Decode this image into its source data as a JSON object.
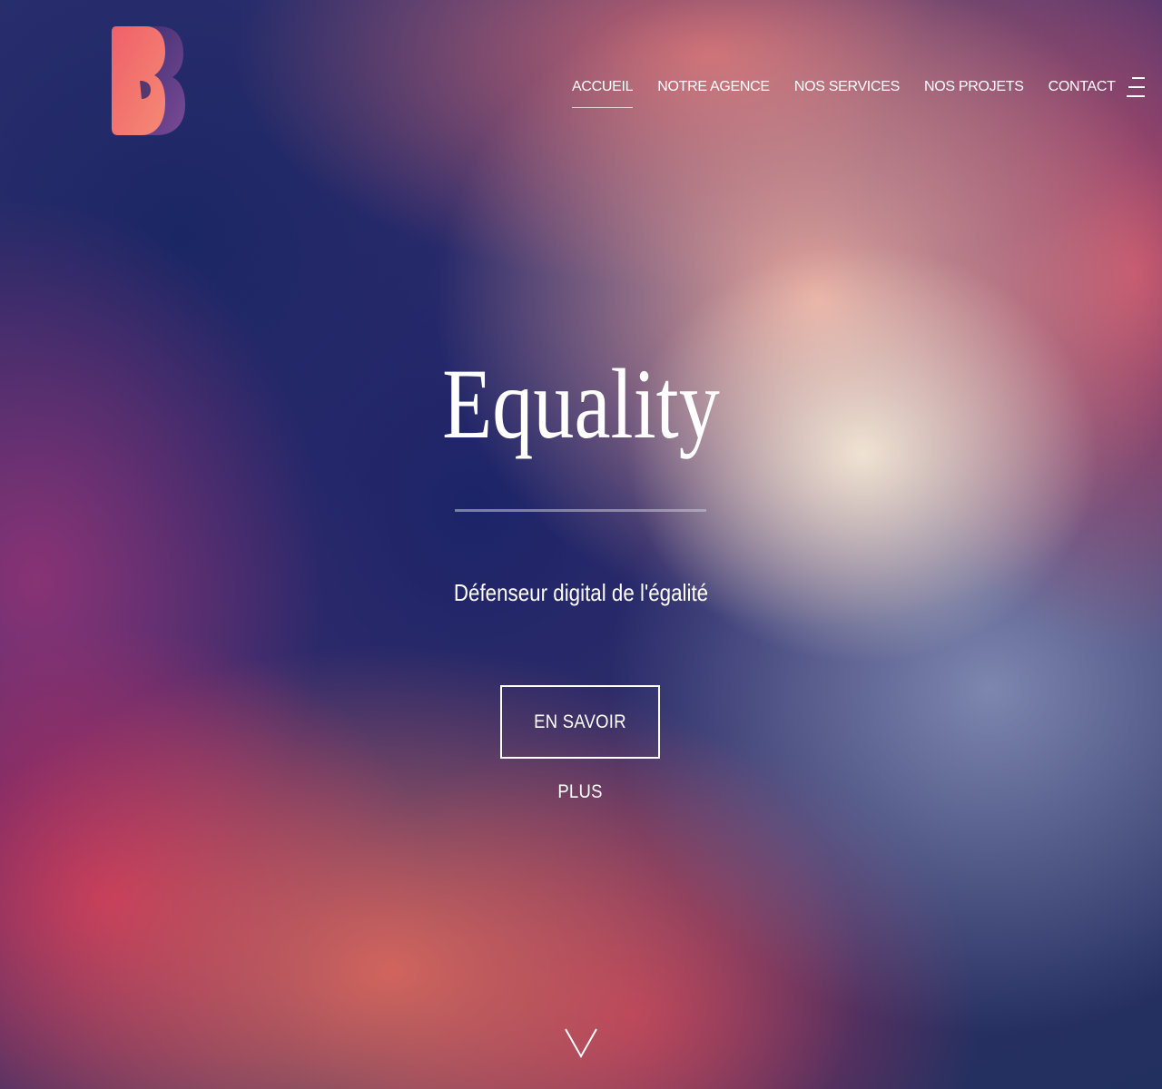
{
  "nav": {
    "items": [
      {
        "label": "ACCUEIL",
        "active": true
      },
      {
        "label": "NOTRE AGENCE",
        "active": false
      },
      {
        "label": "NOS SERVICES",
        "active": false
      },
      {
        "label": "NOS PROJETS",
        "active": false
      },
      {
        "label": "CONTACT",
        "active": false
      }
    ],
    "menu_icon": "hamburger-menu-icon"
  },
  "logo": {
    "icon": "b-logo-icon",
    "colors": {
      "front": "#f06a6a",
      "back": "#6b3f8f"
    }
  },
  "hero": {
    "title": "Equality",
    "subtitle": "Défenseur digital de l'égalité",
    "cta_label": "EN SAVOIR PLUS",
    "scroll_icon": "chevron-down-icon"
  },
  "colors": {
    "text": "#ffffff",
    "navy": "#1f2b63",
    "coral": "#f06a6a",
    "peach": "#f4e8d6",
    "crimson": "#c82c58"
  }
}
